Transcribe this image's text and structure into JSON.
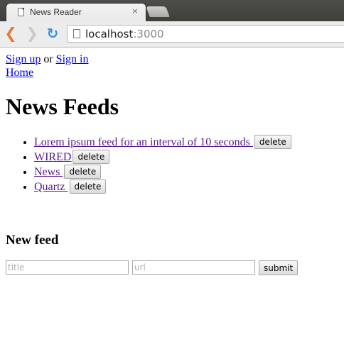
{
  "browser": {
    "tab_title": "News Reader",
    "tab_close": "×",
    "url_host": "localhost",
    "url_port": ":3000",
    "back_glyph": "❮",
    "forward_glyph": "❯",
    "reload_glyph": "↻",
    "icons": [
      "page-icon",
      "close-icon",
      "back-arrow-icon",
      "forward-arrow-icon",
      "reload-icon"
    ]
  },
  "auth": {
    "sign_up": "Sign up",
    "or": " or ",
    "sign_in": "Sign in"
  },
  "nav": {
    "home": "Home"
  },
  "heading": "News Feeds",
  "feeds": [
    {
      "title": "Lorem ipsum feed for an interval of 10 seconds ",
      "delete_label": "delete"
    },
    {
      "title": "WIRED",
      "delete_label": "delete"
    },
    {
      "title": "News ",
      "delete_label": "delete"
    },
    {
      "title": "Quartz ",
      "delete_label": "delete"
    }
  ],
  "new_feed": {
    "heading": "New feed",
    "title_placeholder": "title",
    "url_placeholder": "url",
    "title_value": "",
    "url_value": "",
    "submit_label": "submit"
  },
  "colors": {
    "link": "#0000ee",
    "visited_link": "#551a8b",
    "back_arrow": "#e27c38",
    "reload": "#3c8fd7"
  }
}
